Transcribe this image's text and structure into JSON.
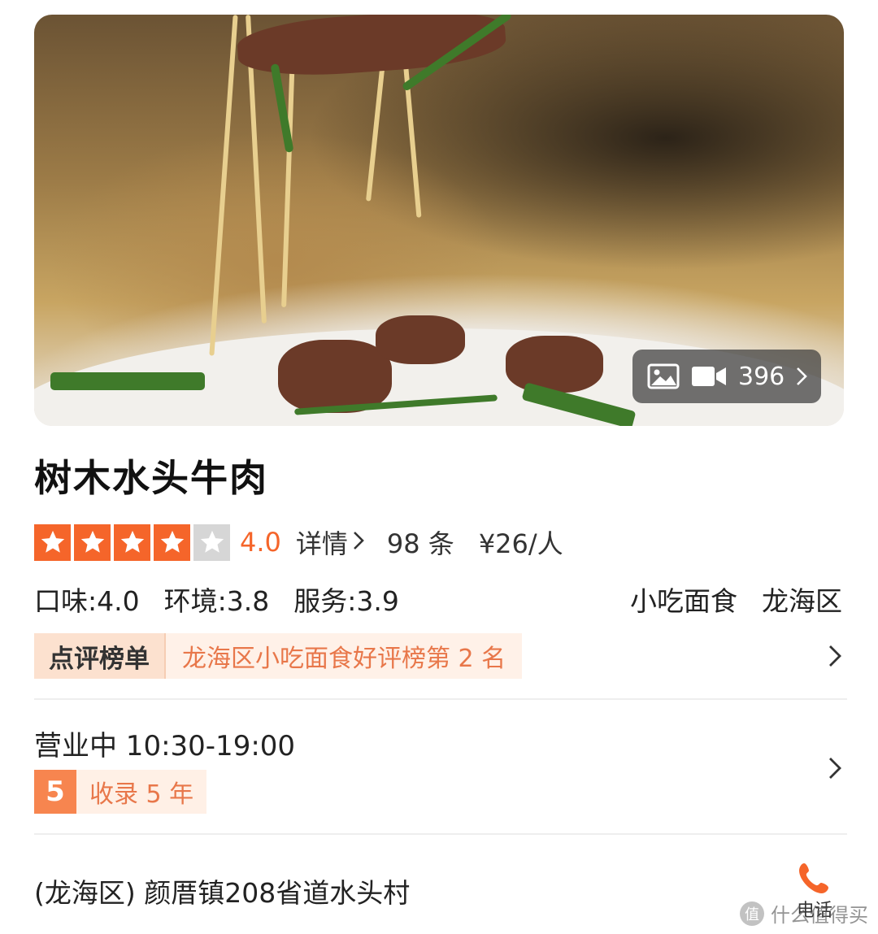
{
  "hero": {
    "media_count": "396",
    "photo_icon": "image-icon",
    "video_icon": "video-icon",
    "chevron_icon": "chevron-right-icon"
  },
  "shop": {
    "name": "树木水头牛肉",
    "stars": 4,
    "stars_max": 5,
    "score": "4.0",
    "detail_label": "详情",
    "review_count": "98 条",
    "price": "¥26/人",
    "sub_scores": [
      "口味:4.0",
      "环境:3.8",
      "服务:3.9"
    ],
    "category": "小吃面食",
    "district": "龙海区"
  },
  "ranking": {
    "badge_label": "点评榜单",
    "text": "龙海区小吃面食好评榜第 2 名"
  },
  "hours": {
    "status_line": "营业中 10:30-19:00",
    "years_number": "5",
    "years_label": "收录 5 年"
  },
  "address": {
    "text": "(龙海区) 颜厝镇208省道水头村",
    "phone_label": "电话",
    "phone_icon": "phone-icon"
  },
  "colors": {
    "accent": "#f5652a",
    "star_off": "#d6d6d6",
    "tag_bg": "#fff1e8"
  },
  "watermark": {
    "text": "值 什么值得买",
    "badge": "值"
  }
}
